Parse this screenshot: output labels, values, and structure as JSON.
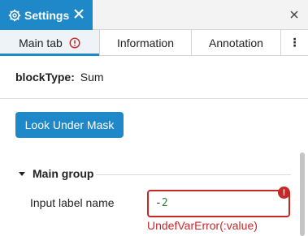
{
  "window": {
    "title": "Settings",
    "icons": {
      "settings": "gear-icon",
      "tab_close": "close-icon",
      "window_close": "close-icon"
    }
  },
  "tabs": [
    {
      "label": "Main tab",
      "active": true,
      "has_warning": true
    },
    {
      "label": "Information",
      "active": false
    },
    {
      "label": "Annotation",
      "active": false
    },
    {
      "label": "⋮",
      "icon": "more-vertical-icon"
    }
  ],
  "block": {
    "type_label": "blockType:",
    "type_value": "Sum"
  },
  "look_under_mask_button": "Look Under Mask",
  "group": {
    "title": "Main group",
    "expanded": true
  },
  "field": {
    "label": "Input label name",
    "value_prefix": "-",
    "value_number": "2",
    "error_badge": "!",
    "error_message": "UndefVarError(:value)"
  },
  "colors": {
    "accent": "#1e88c9",
    "error": "#c62828",
    "number": "#2e7d32"
  }
}
